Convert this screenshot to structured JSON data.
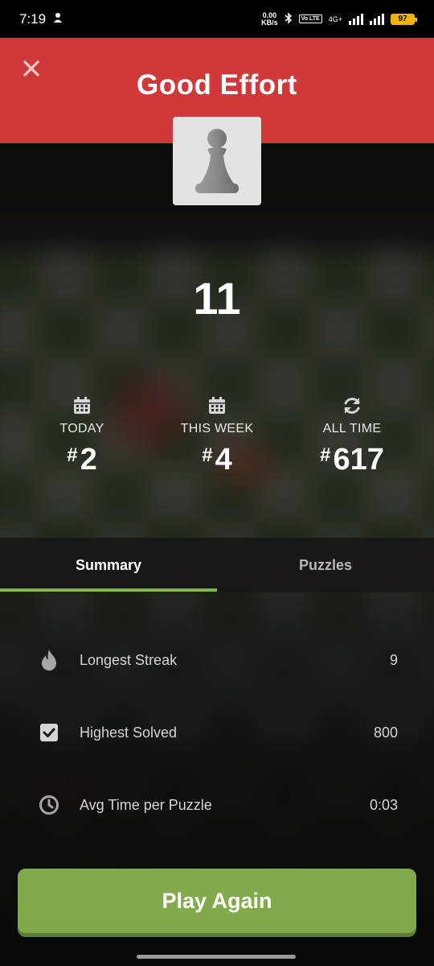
{
  "status_bar": {
    "time": "7:19",
    "net_speed_value": "0.00",
    "net_speed_unit": "KB/s",
    "network": "4G+",
    "volte": "Vo LTE",
    "battery": "97"
  },
  "header": {
    "title": "Good Effort"
  },
  "puzzle_score": "11",
  "rankings": [
    {
      "label": "TODAY",
      "rank": "2",
      "icon": "calendar-icon"
    },
    {
      "label": "THIS WEEK",
      "rank": "4",
      "icon": "calendar-icon"
    },
    {
      "label": "ALL TIME",
      "rank": "617",
      "icon": "refresh-icon"
    }
  ],
  "rank_prefix": "#",
  "tabs": [
    {
      "label": "Summary",
      "active": true
    },
    {
      "label": "Puzzles",
      "active": false
    }
  ],
  "summary": [
    {
      "label": "Longest Streak",
      "value": "9",
      "icon": "flame-icon"
    },
    {
      "label": "Highest Solved",
      "value": "800",
      "icon": "checkbox-icon"
    },
    {
      "label": "Avg Time per Puzzle",
      "value": "0:03",
      "icon": "clock-icon"
    }
  ],
  "play_again_label": "Play Again",
  "colors": {
    "header_red": "#d0393a",
    "accent_green": "#81b64c",
    "button_green": "#81aa4c"
  }
}
